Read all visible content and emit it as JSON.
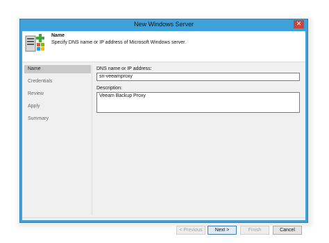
{
  "window": {
    "title": "New Windows Server",
    "close_glyph": "✕"
  },
  "header": {
    "title": "Name",
    "description": "Specify DNS name or IP address of Microsoft Windows server.",
    "icon": "windows-server-add-icon"
  },
  "nav": {
    "items": [
      {
        "label": "Name",
        "active": true
      },
      {
        "label": "Credentials",
        "active": false
      },
      {
        "label": "Review",
        "active": false
      },
      {
        "label": "Apply",
        "active": false
      },
      {
        "label": "Summary",
        "active": false
      }
    ]
  },
  "form": {
    "dns_label": "DNS name or IP address:",
    "dns_value": "sn-veeamproxy",
    "description_label": "Description:",
    "description_value": "Veeam Backup Proxy"
  },
  "buttons": {
    "previous": "< Previous",
    "next": "Next >",
    "finish": "Finish",
    "cancel": "Cancel"
  },
  "colors": {
    "frame": "#3ea1d9",
    "close": "#c9443a",
    "active_nav": "#c9c9c9"
  }
}
